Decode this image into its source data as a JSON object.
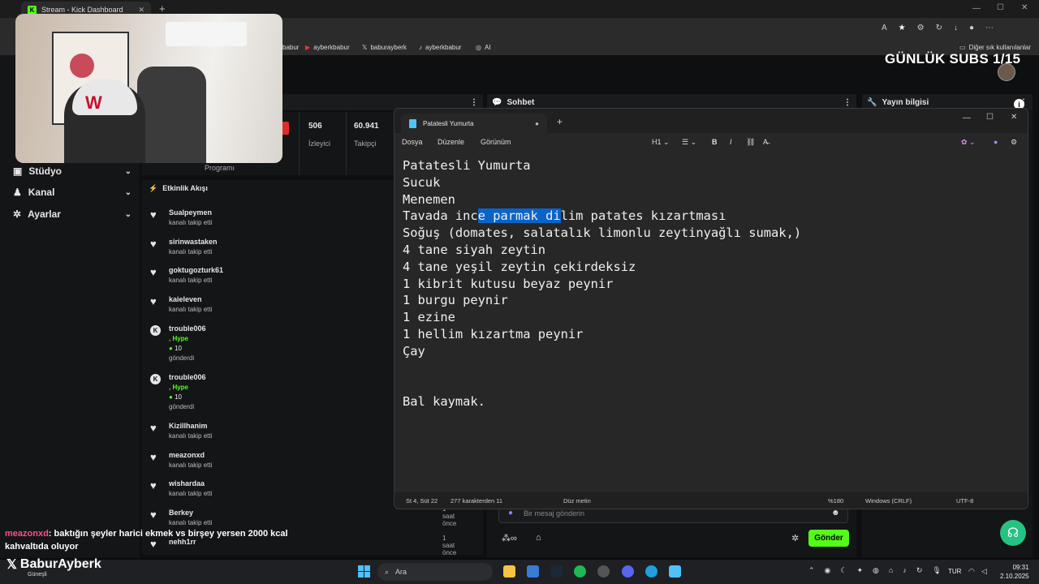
{
  "browser": {
    "tab_title": "Stream - Kick Dashboard",
    "bookmarks": [
      "babur",
      "ayberkbabur",
      "baburayberk",
      "ayberkbabur",
      "AI"
    ],
    "other_bookmarks": "Diğer sık kullanılanlar"
  },
  "overlay": {
    "goal_text": "GÜNLÜK SUBS 1/15",
    "chat_user": "meazonxd",
    "chat_message": ": baktığın şeyler harici ekmek vs birşey yersen 2000 kcal kahvaltıda oluyor",
    "brand_name": "BaburAyberk",
    "brand_sub": "Güneşli"
  },
  "sidebar": {
    "items": [
      {
        "label": "Stüdyo"
      },
      {
        "label": "Kanal"
      },
      {
        "label": "Ayarlar"
      }
    ]
  },
  "stats": {
    "program_label": "Programı",
    "viewers_value": "506",
    "viewers_label": "İzleyici",
    "followers_value": "60.941",
    "followers_label": "Takipçi"
  },
  "panels": {
    "chat_title": "Sohbet",
    "info_title": "Yayın bilgisi",
    "activity_title": "Etkinlik Akışı",
    "message_placeholder": "Bir mesaj gönderin",
    "send_label": "Gönder"
  },
  "activity": [
    {
      "name": "Sualpeymen",
      "sub": "kanalı takip etti",
      "type": "follow"
    },
    {
      "name": "sirinwastaken",
      "sub": "kanalı takip etti",
      "type": "follow"
    },
    {
      "name": "goktugozturk61",
      "sub": "kanalı takip etti",
      "type": "follow"
    },
    {
      "name": "kaieleven",
      "sub": "kanalı takip etti",
      "type": "follow"
    },
    {
      "name": "trouble006",
      "hype": ", Hype",
      "amount": "10",
      "sub": "gönderdi",
      "type": "kicks"
    },
    {
      "name": "trouble006",
      "hype": ", Hype",
      "amount": "10",
      "sub": "gönderdi",
      "type": "kicks"
    },
    {
      "name": "Kizillhanim",
      "sub": "kanalı takip etti",
      "type": "follow"
    },
    {
      "name": "meazonxd",
      "sub": "kanalı takip etti",
      "type": "follow"
    },
    {
      "name": "wishardaa",
      "sub": "kanalı takip etti",
      "type": "follow"
    },
    {
      "name": "Berkey",
      "sub": "kanalı takip etti",
      "type": "follow",
      "time": "1 saat önce"
    },
    {
      "name": "nehh1rr",
      "sub": "",
      "type": "follow",
      "time": "1 saat önce"
    }
  ],
  "notepad": {
    "tab_title": "Patatesli Yumurta",
    "menu": [
      "Dosya",
      "Düzenle",
      "Görünüm"
    ],
    "format_label": "H1",
    "lines": [
      "Patatesli Yumurta",
      "Sucuk",
      "Menemen",
      "Tavada ince parmak dilim patates kızartması",
      "Soğuş (domates, salatalık limonlu zeytinyağlı sumak,)",
      "4 tane siyah zeytin",
      "4 tane yeşil zeytin çekirdeksiz",
      "1 kibrit kutusu beyaz peynir",
      "1 burgu peynir",
      "1 ezine",
      "1 hellim kızartma peynir",
      "Çay",
      "",
      "",
      "Bal kaymak."
    ],
    "selection": {
      "line": 3,
      "before": "Tavada inc",
      "selected": "e parmak di",
      "after": "lim patates kızartması"
    },
    "status": {
      "position": "St 4, Süt 22",
      "chars": "277 karakterden 11",
      "format": "Düz metin",
      "zoom": "%180",
      "line_ending": "Windows (CRLF)",
      "encoding": "UTF-8"
    }
  },
  "taskbar": {
    "search_label": "Ara",
    "lang": "TUR",
    "time": "09:31",
    "date": "2.10.2025"
  }
}
